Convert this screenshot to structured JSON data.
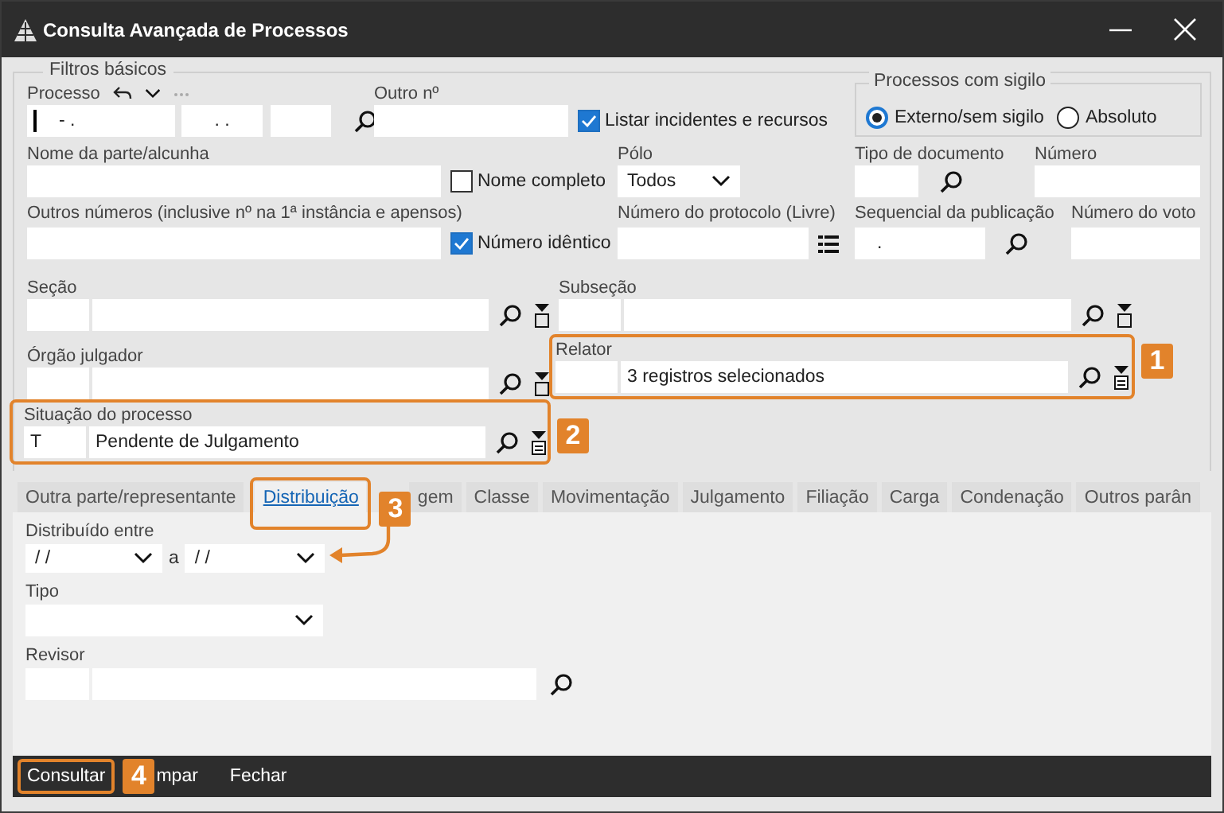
{
  "window": {
    "title": "Consulta Avançada de Processos"
  },
  "filtros_basicos": {
    "title": "Filtros básicos",
    "processo": {
      "label": "Processo",
      "segments": [
        "- .",
        ". ."
      ]
    },
    "outro_numero": {
      "label": "Outro nº"
    },
    "listar_incidentes": {
      "label": "Listar incidentes e recursos",
      "checked": true
    },
    "sigilo": {
      "title": "Processos com sigilo",
      "options": [
        {
          "label": "Externo/sem sigilo",
          "selected": true
        },
        {
          "label": "Absoluto",
          "selected": false
        }
      ]
    },
    "nome_parte": {
      "label": "Nome da parte/alcunha"
    },
    "nome_completo": {
      "label": "Nome completo",
      "checked": false
    },
    "polo": {
      "label": "Pólo",
      "value": "Todos"
    },
    "tipo_documento": {
      "label": "Tipo de documento"
    },
    "numero": {
      "label": "Número"
    },
    "outros_numeros": {
      "label": "Outros números  (inclusive nº na 1ª instância e apensos)"
    },
    "numero_identico": {
      "label": "Número idêntico",
      "checked": true
    },
    "protocolo": {
      "label": "Número do protocolo (Livre)"
    },
    "sequencial": {
      "label": "Sequencial da publicação",
      "value": "."
    },
    "numero_voto": {
      "label": "Número do voto"
    },
    "lookups": [
      {
        "label": "Seção",
        "filter_active": false
      },
      {
        "label": "Subseção",
        "filter_active": false
      },
      {
        "label": "Órgão julgador",
        "filter_active": false
      },
      {
        "label": "Relator",
        "value": "3 registros selecionados",
        "filter_active": true,
        "callout": "1"
      },
      {
        "label": "Situação do processo",
        "code": "T",
        "value": "Pendente de Julgamento",
        "filter_active": true,
        "callout": "2"
      }
    ]
  },
  "tabs": [
    {
      "label": "Outra parte/representante",
      "selected": false
    },
    {
      "label": "Distribuição",
      "selected": true,
      "callout": "3"
    },
    {
      "label": "gem",
      "selected": false
    },
    {
      "label": "Classe",
      "selected": false
    },
    {
      "label": "Movimentação",
      "selected": false
    },
    {
      "label": "Julgamento",
      "selected": false
    },
    {
      "label": "Filiação",
      "selected": false
    },
    {
      "label": "Carga",
      "selected": false
    },
    {
      "label": "Condenação",
      "selected": false
    },
    {
      "label": "Outros parân",
      "selected": false
    }
  ],
  "distribuicao": {
    "label": "Distribuído entre",
    "from": "/ /",
    "separator": "a",
    "to": "/ /",
    "tipo": {
      "label": "Tipo"
    },
    "revisor": {
      "label": "Revisor"
    }
  },
  "buttons": [
    {
      "label": "Consultar",
      "callout": "4"
    },
    {
      "label": "mpar"
    },
    {
      "label": "Fechar"
    }
  ]
}
